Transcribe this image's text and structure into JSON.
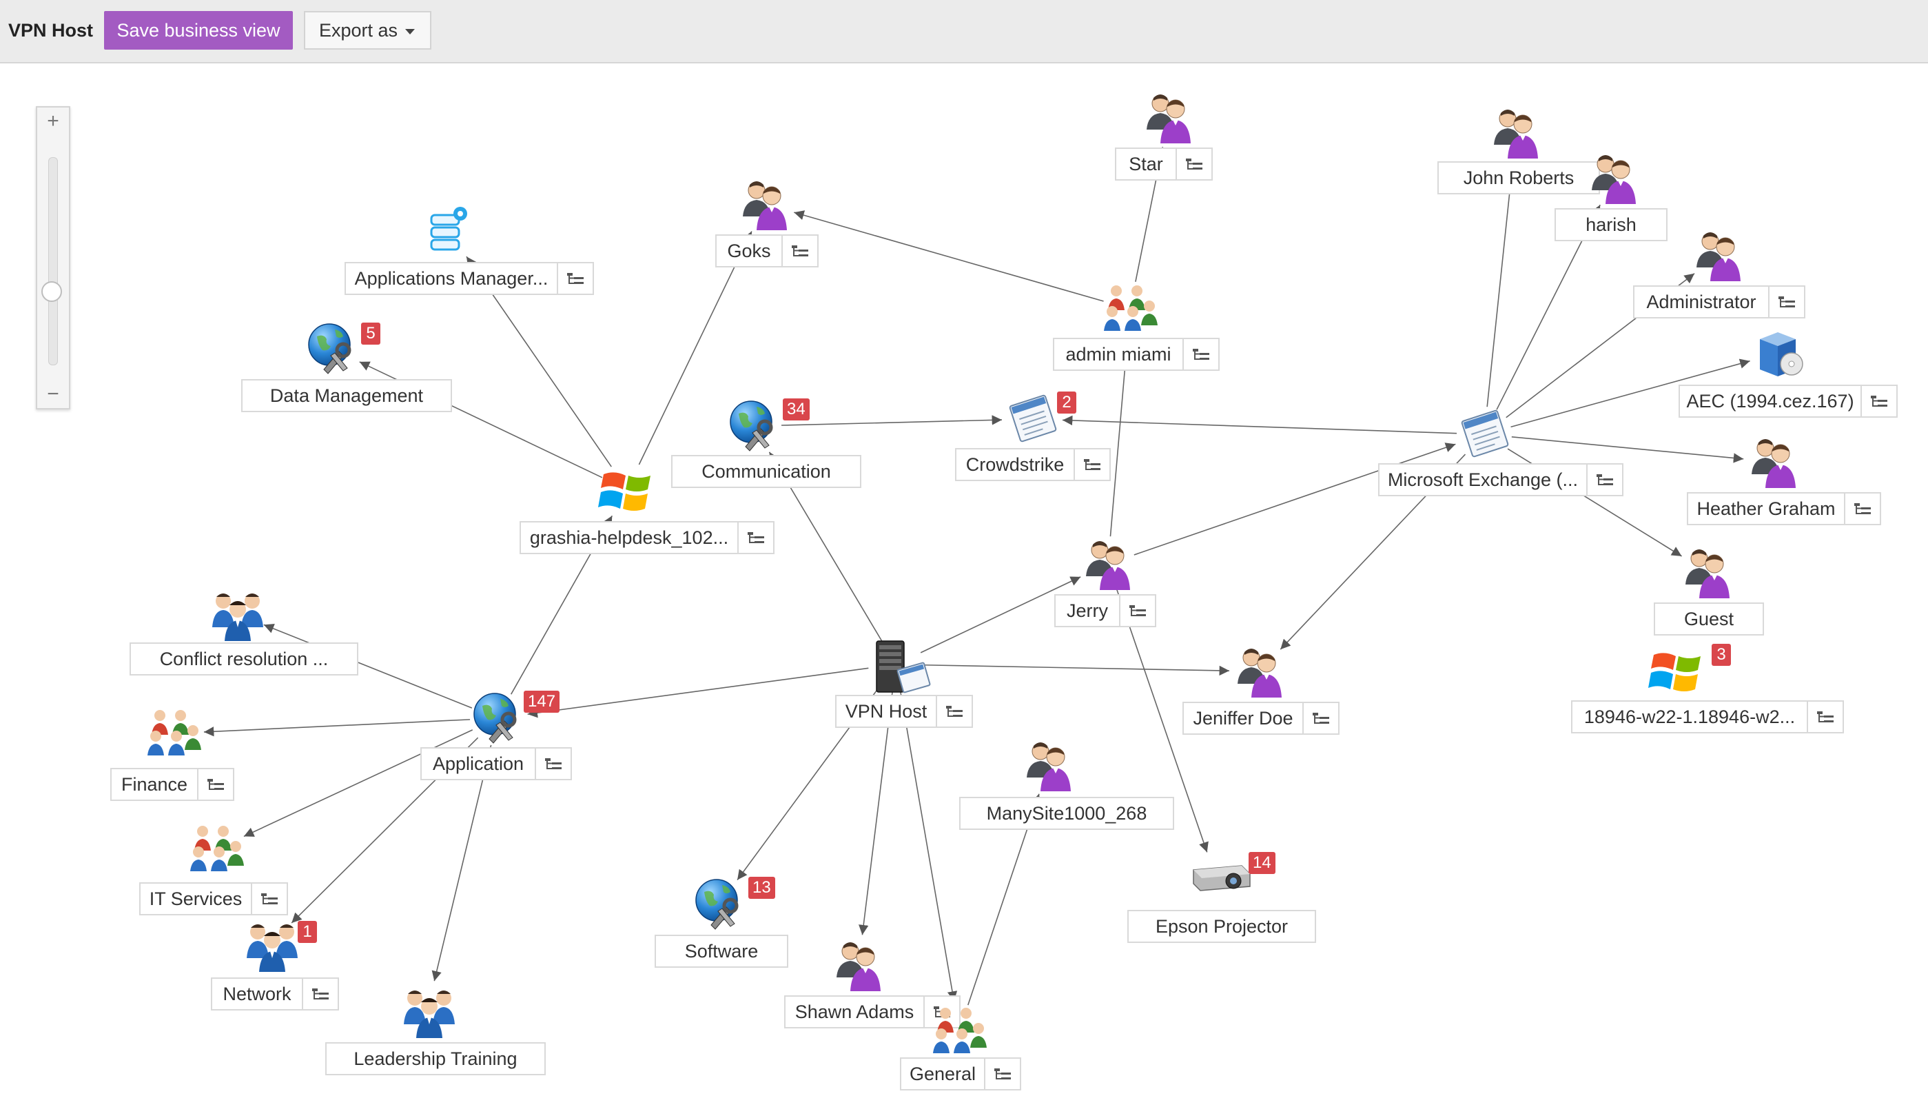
{
  "toolbar": {
    "title": "VPN Host",
    "save_label": "Save business view",
    "export_label": "Export as"
  },
  "zoom": {
    "plus": "+",
    "minus": "−"
  },
  "colors": {
    "accent": "#a35bc2",
    "badge": "#d9464b",
    "edge": "#666666",
    "person_shirt": "#9c3fc9"
  },
  "nodes": [
    {
      "id": "vpn",
      "label": "VPN Host",
      "icon": "server-icon",
      "tree": true
    },
    {
      "id": "application",
      "label": "Application",
      "icon": "globe-wrench-icon",
      "badge": "147",
      "tree": true
    },
    {
      "id": "grashia",
      "label": "grashia-helpdesk_102...",
      "icon": "windows-logo-icon",
      "tree": true
    },
    {
      "id": "appmgr",
      "label": "Applications Manager...",
      "icon": "app-server-gear-icon",
      "tree": true
    },
    {
      "id": "datamgmt",
      "label": "Data Management",
      "icon": "globe-wrench-icon",
      "badge": "5",
      "tree": false
    },
    {
      "id": "goks",
      "label": "Goks",
      "icon": "user-icon",
      "tree": true
    },
    {
      "id": "communication",
      "label": "Communication",
      "icon": "globe-wrench-icon",
      "badge": "34",
      "tree": false
    },
    {
      "id": "crowdstrike",
      "label": "Crowdstrike",
      "icon": "document-app-icon",
      "badge": "2",
      "tree": true
    },
    {
      "id": "adminmiami",
      "label": "admin miami",
      "icon": "user-group-icon",
      "tree": true
    },
    {
      "id": "star",
      "label": "Star",
      "icon": "user-icon",
      "tree": true
    },
    {
      "id": "jerry",
      "label": "Jerry",
      "icon": "user-icon",
      "tree": true
    },
    {
      "id": "exchange",
      "label": "Microsoft Exchange (...",
      "icon": "document-app-icon",
      "tree": true
    },
    {
      "id": "johnroberts",
      "label": "John Roberts",
      "icon": "user-icon",
      "tree": false
    },
    {
      "id": "harish",
      "label": "harish",
      "icon": "user-icon",
      "tree": false
    },
    {
      "id": "administrator",
      "label": "Administrator",
      "icon": "user-icon",
      "tree": true
    },
    {
      "id": "aec",
      "label": "AEC (1994.cez.167)",
      "icon": "software-box-icon",
      "tree": true
    },
    {
      "id": "heather",
      "label": "Heather Graham",
      "icon": "user-icon",
      "tree": true
    },
    {
      "id": "guest",
      "label": "Guest",
      "icon": "user-icon",
      "tree": false
    },
    {
      "id": "w22",
      "label": "18946-w22-1.18946-w2...",
      "icon": "windows-logo-icon",
      "badge": "3",
      "tree": true
    },
    {
      "id": "jeniffer",
      "label": "Jeniffer Doe",
      "icon": "user-icon",
      "tree": true
    },
    {
      "id": "conflict",
      "label": "Conflict resolution ...",
      "icon": "team-icon",
      "tree": false
    },
    {
      "id": "finance",
      "label": "Finance",
      "icon": "user-group-icon",
      "tree": true
    },
    {
      "id": "itservices",
      "label": "IT Services",
      "icon": "user-group-icon",
      "tree": true
    },
    {
      "id": "network",
      "label": "Network",
      "icon": "team-icon",
      "badge": "1",
      "tree": true
    },
    {
      "id": "leadership",
      "label": "Leadership Training",
      "icon": "team-icon",
      "tree": false
    },
    {
      "id": "software",
      "label": "Software",
      "icon": "globe-wrench-icon",
      "badge": "13",
      "tree": false
    },
    {
      "id": "shawn",
      "label": "Shawn Adams",
      "icon": "user-icon",
      "tree": true
    },
    {
      "id": "general",
      "label": "General",
      "icon": "user-group-icon",
      "tree": true
    },
    {
      "id": "manysite",
      "label": "ManySite1000_268",
      "icon": "user-icon",
      "tree": false
    },
    {
      "id": "epson",
      "label": "Epson Projector",
      "icon": "projector-icon",
      "badge": "14",
      "tree": false
    }
  ],
  "edges": [
    [
      "vpn",
      "application"
    ],
    [
      "vpn",
      "communication"
    ],
    [
      "vpn",
      "jerry"
    ],
    [
      "vpn",
      "jeniffer"
    ],
    [
      "vpn",
      "software"
    ],
    [
      "vpn",
      "shawn"
    ],
    [
      "vpn",
      "general"
    ],
    [
      "application",
      "grashia"
    ],
    [
      "application",
      "conflict"
    ],
    [
      "application",
      "finance"
    ],
    [
      "application",
      "itservices"
    ],
    [
      "application",
      "network"
    ],
    [
      "application",
      "leadership"
    ],
    [
      "grashia",
      "appmgr"
    ],
    [
      "grashia",
      "datamgmt"
    ],
    [
      "grashia",
      "goks"
    ],
    [
      "communication",
      "crowdstrike"
    ],
    [
      "adminmiami",
      "goks"
    ],
    [
      "adminmiami",
      "star"
    ],
    [
      "jerry",
      "adminmiami"
    ],
    [
      "jerry",
      "exchange"
    ],
    [
      "jerry",
      "epson"
    ],
    [
      "exchange",
      "crowdstrike"
    ],
    [
      "exchange",
      "johnroberts"
    ],
    [
      "exchange",
      "harish"
    ],
    [
      "exchange",
      "administrator"
    ],
    [
      "exchange",
      "aec"
    ],
    [
      "exchange",
      "heather"
    ],
    [
      "exchange",
      "guest"
    ],
    [
      "exchange",
      "jeniffer"
    ],
    [
      "general",
      "manysite"
    ]
  ]
}
